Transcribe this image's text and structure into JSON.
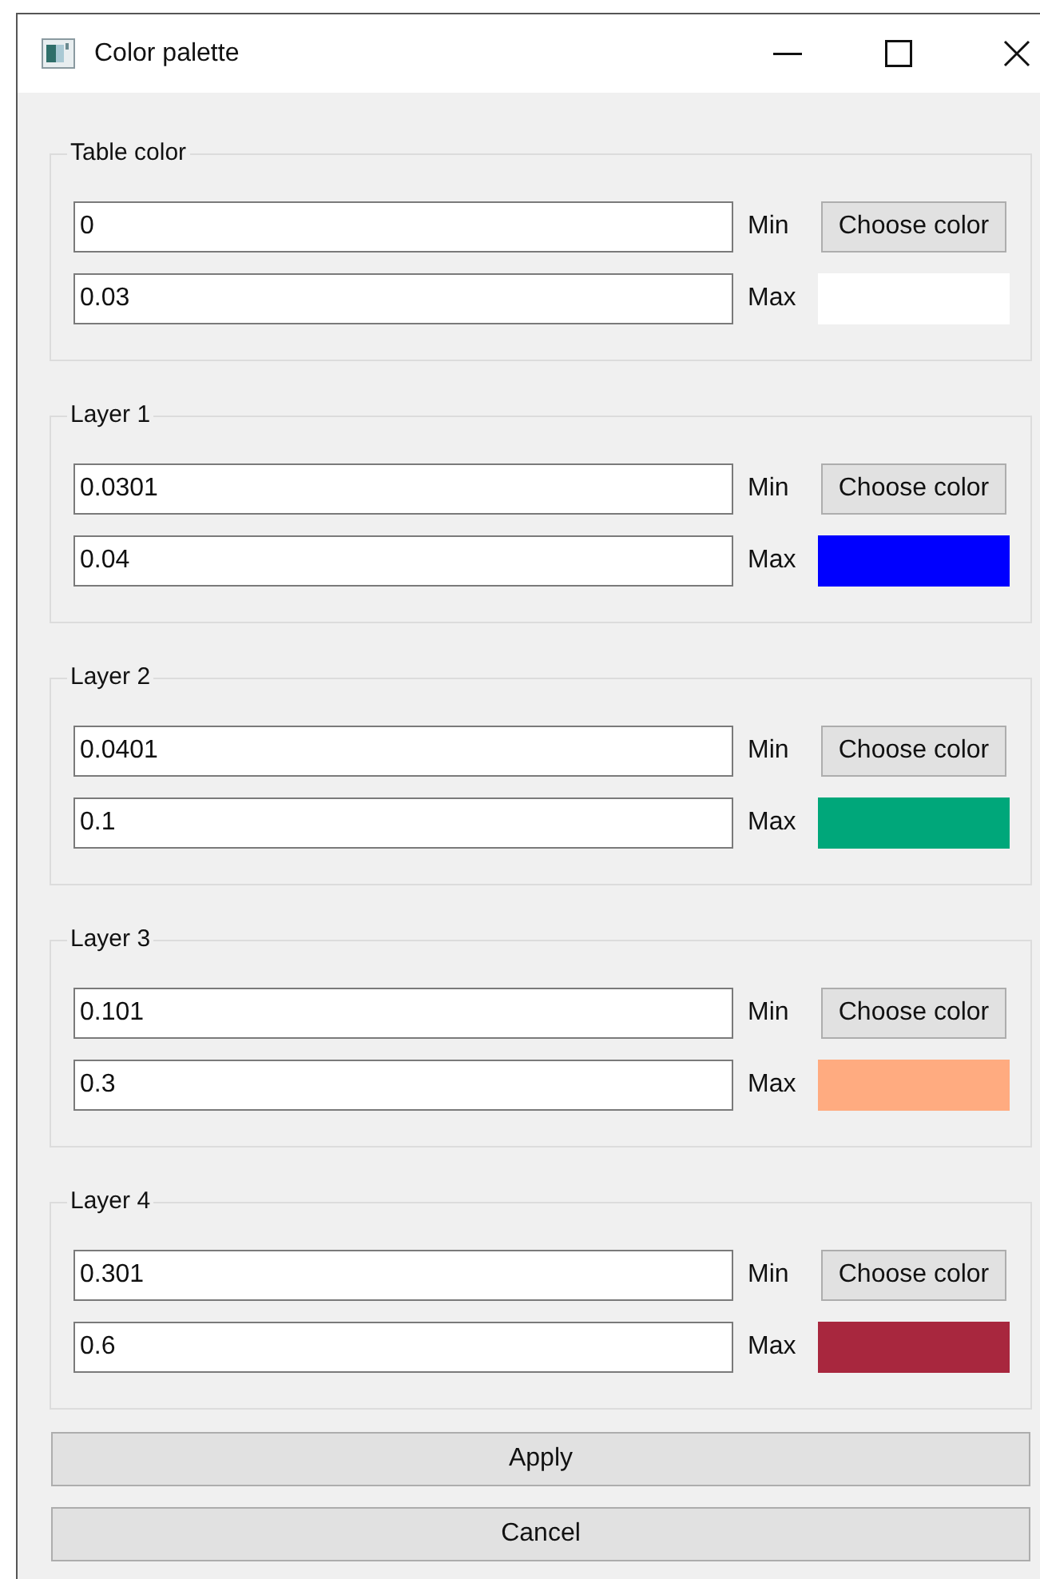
{
  "window": {
    "title": "Color palette"
  },
  "groups": [
    {
      "title": "Table color",
      "min_value": "0",
      "min_label": "Min",
      "max_value": "0.03",
      "max_label": "Max",
      "button": "Choose color",
      "color": "#ffffff"
    },
    {
      "title": "Layer 1",
      "min_value": "0.0301",
      "min_label": "Min",
      "max_value": "0.04",
      "max_label": "Max",
      "button": "Choose color",
      "color": "#0000ff"
    },
    {
      "title": "Layer 2",
      "min_value": "0.0401",
      "min_label": "Min",
      "max_value": "0.1",
      "max_label": "Max",
      "button": "Choose color",
      "color": "#00a77a"
    },
    {
      "title": "Layer 3",
      "min_value": "0.101",
      "min_label": "Min",
      "max_value": "0.3",
      "max_label": "Max",
      "button": "Choose color",
      "color": "#ffab80"
    },
    {
      "title": "Layer 4",
      "min_value": "0.301",
      "min_label": "Min",
      "max_value": "0.6",
      "max_label": "Max",
      "button": "Choose color",
      "color": "#a8273e"
    }
  ],
  "buttons": [
    "Apply",
    "Cancel"
  ]
}
